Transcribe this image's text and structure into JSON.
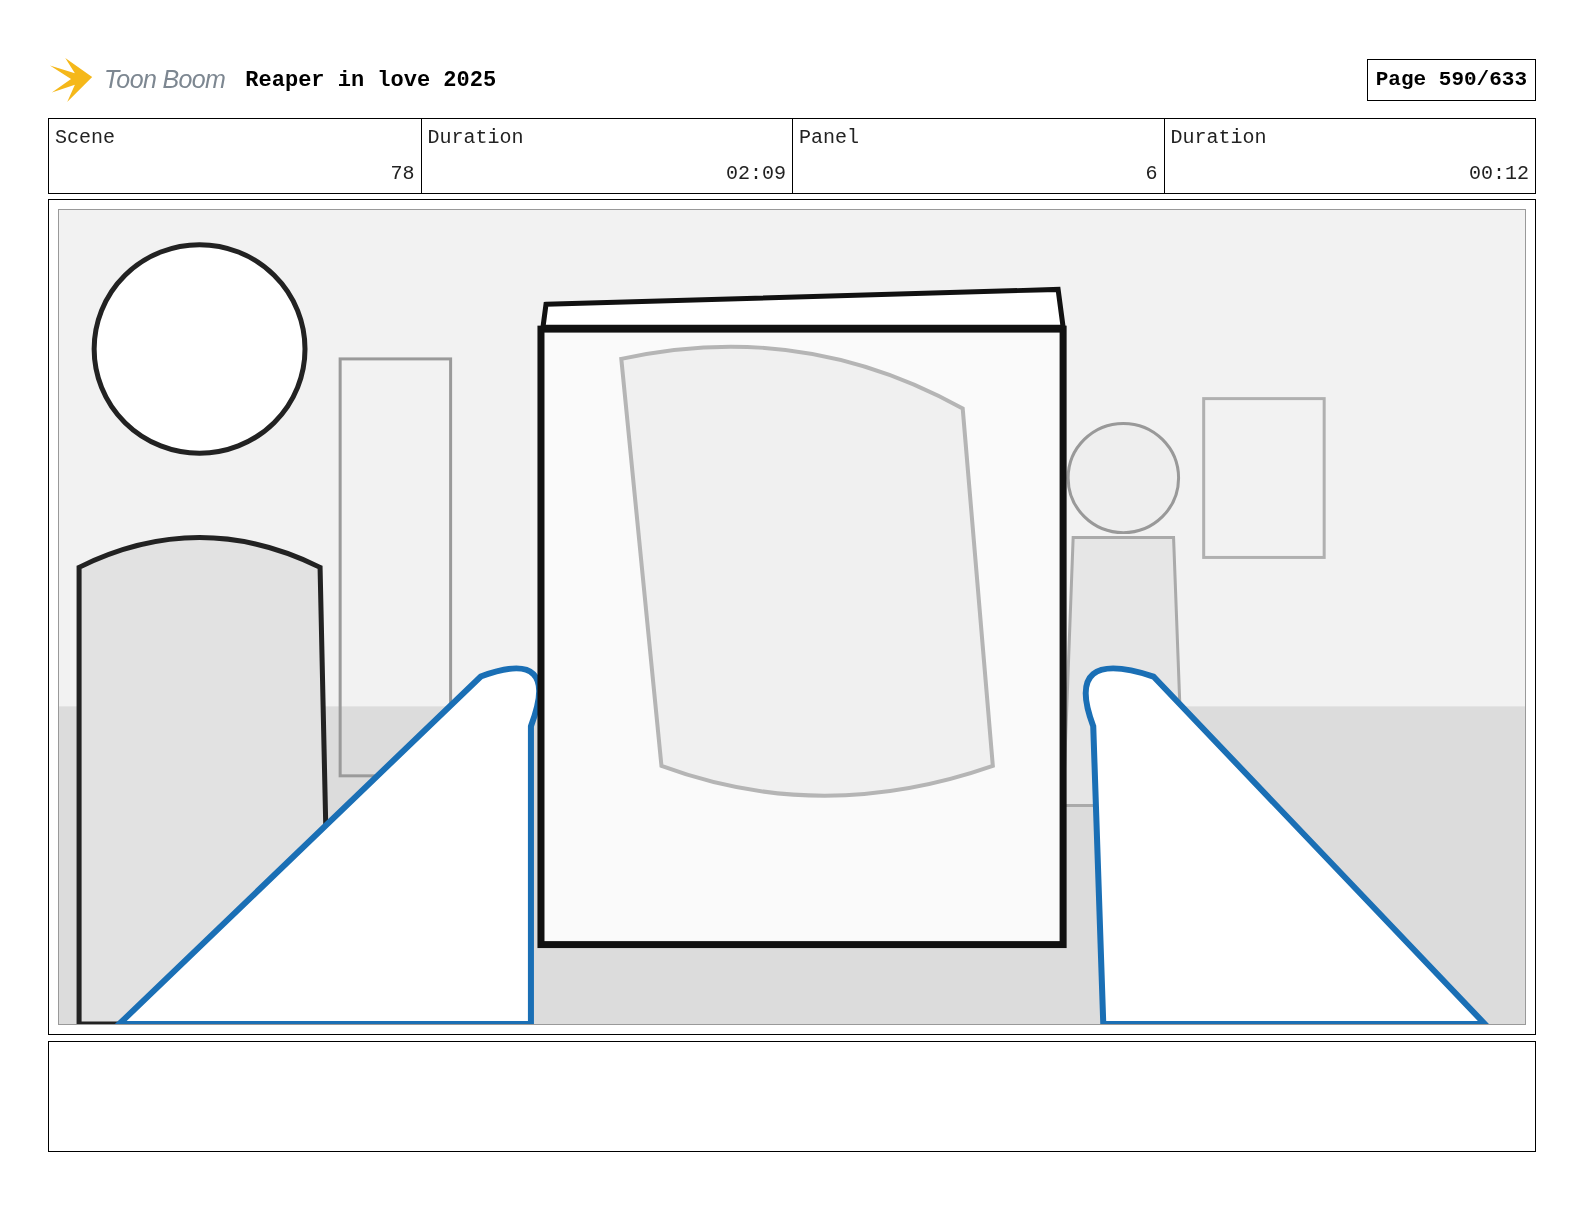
{
  "header": {
    "logo_text": "Toon Boom",
    "project_title": "Reaper in love 2025",
    "page": "Page 590/633"
  },
  "info_table": {
    "columns": [
      "Scene",
      "Duration",
      "Panel",
      "Duration"
    ],
    "row": [
      "78",
      "02:09",
      "6",
      "00:12"
    ]
  }
}
